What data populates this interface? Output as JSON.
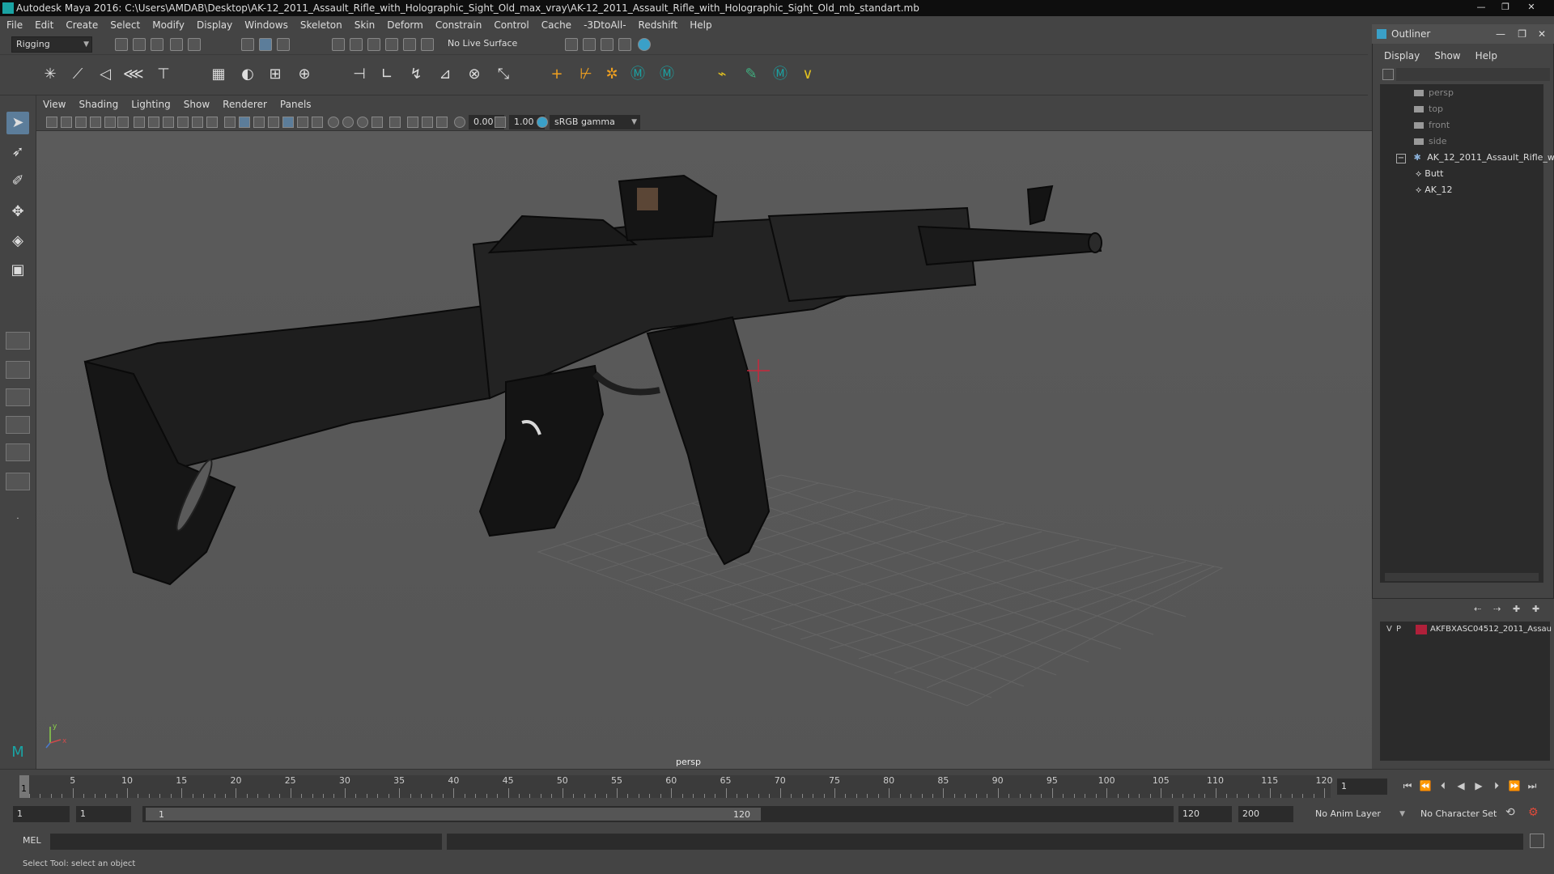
{
  "window": {
    "title": "Autodesk Maya 2016: C:\\Users\\AMDAB\\Desktop\\AK-12_2011_Assault_Rifle_with_Holographic_Sight_Old_max_vray\\AK-12_2011_Assault_Rifle_with_Holographic_Sight_Old_mb_standart.mb",
    "minimize": "—",
    "maximize": "❐",
    "close": "✕"
  },
  "menubar": [
    "File",
    "Edit",
    "Create",
    "Select",
    "Modify",
    "Display",
    "Windows",
    "Skeleton",
    "Skin",
    "Deform",
    "Constrain",
    "Control",
    "Cache",
    "-3DtoAll-",
    "Redshift",
    "Help"
  ],
  "statusline": {
    "mode": "Rigging",
    "live_surface": "No Live Surface"
  },
  "viewport": {
    "menus": [
      "View",
      "Shading",
      "Lighting",
      "Show",
      "Renderer",
      "Panels"
    ],
    "exposure": "0.00",
    "gamma": "1.00",
    "color_space": "sRGB gamma",
    "camera_label": "persp",
    "axis_y": "y",
    "axis_x": "x"
  },
  "outliner": {
    "title": "Outliner",
    "menus": [
      "Display",
      "Show",
      "Help"
    ],
    "items": [
      {
        "label": "persp",
        "type": "camera"
      },
      {
        "label": "top",
        "type": "camera"
      },
      {
        "label": "front",
        "type": "camera"
      },
      {
        "label": "side",
        "type": "camera"
      },
      {
        "label": "AK_12_2011_Assault_Rifle_w",
        "type": "group",
        "expander": "−"
      },
      {
        "label": "Butt",
        "type": "mesh"
      },
      {
        "label": "AK_12",
        "type": "mesh"
      }
    ]
  },
  "layers": {
    "v": "V",
    "p": "P",
    "layer_name": "AKFBXASC04512_2011_Assau",
    "layer_color": "#b0203a"
  },
  "timeline": {
    "ticks": [
      "5",
      "10",
      "15",
      "20",
      "25",
      "30",
      "35",
      "40",
      "45",
      "50",
      "55",
      "60",
      "65",
      "70",
      "75",
      "80",
      "85",
      "90",
      "95",
      "100",
      "105",
      "110",
      "115",
      "120"
    ],
    "start_tick": "1",
    "current_frame": "1"
  },
  "range": {
    "start": "1",
    "playback_start": "1",
    "slider_start": "1",
    "slider_end": "120",
    "playback_end": "120",
    "end": "200",
    "anim_layer": "No Anim Layer",
    "char_set": "No Character Set"
  },
  "command": {
    "label": "MEL"
  },
  "helpline": "Select Tool: select an object",
  "colors": {
    "background": "#444444",
    "viewport": "#5a5a5a",
    "accent": "#5c7d9a",
    "manipulator": "#c8283c"
  }
}
